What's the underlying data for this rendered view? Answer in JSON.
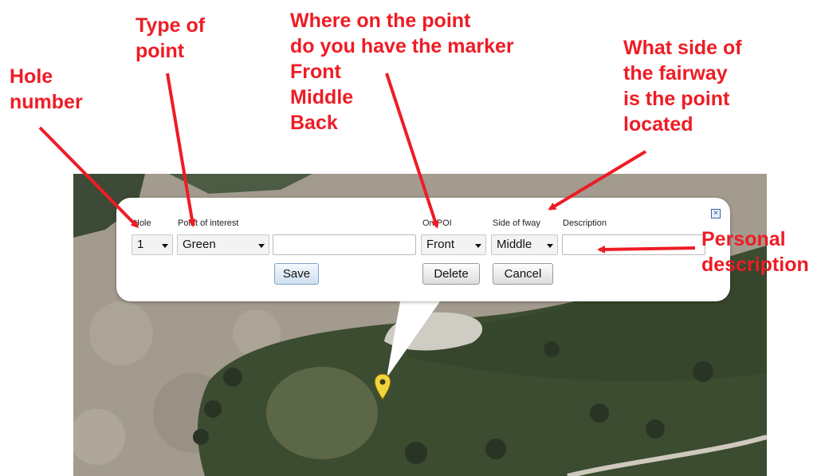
{
  "map": {
    "marker_icon": "map-pin-icon",
    "colors": {
      "sand": "#a49c8f",
      "fairway": "#3a4b2f",
      "green": "#5f6a4a",
      "marker": "#f0d43a"
    }
  },
  "form": {
    "hole": {
      "label": "Hole",
      "value": "1"
    },
    "poi": {
      "label": "Point of interest",
      "value": "Green"
    },
    "custom_name": {
      "value": ""
    },
    "on_poi": {
      "label": "On POI",
      "value": "Front"
    },
    "side": {
      "label": "Side of fway",
      "value": "Middle"
    },
    "description": {
      "label": "Description",
      "value": ""
    },
    "buttons": {
      "save": "Save",
      "delete": "Delete",
      "cancel": "Cancel"
    },
    "close_icon": "close-icon"
  },
  "annotations": {
    "hole": "Hole\nnumber",
    "type": "Type of\npoint",
    "where": "Where on the point\ndo you have the marker\nFront\nMiddle\nBack",
    "side": "What side of\nthe fairway\nis the point\nlocated",
    "personal": "Personal\ndescription"
  },
  "annotation_color": "#ee1c25"
}
